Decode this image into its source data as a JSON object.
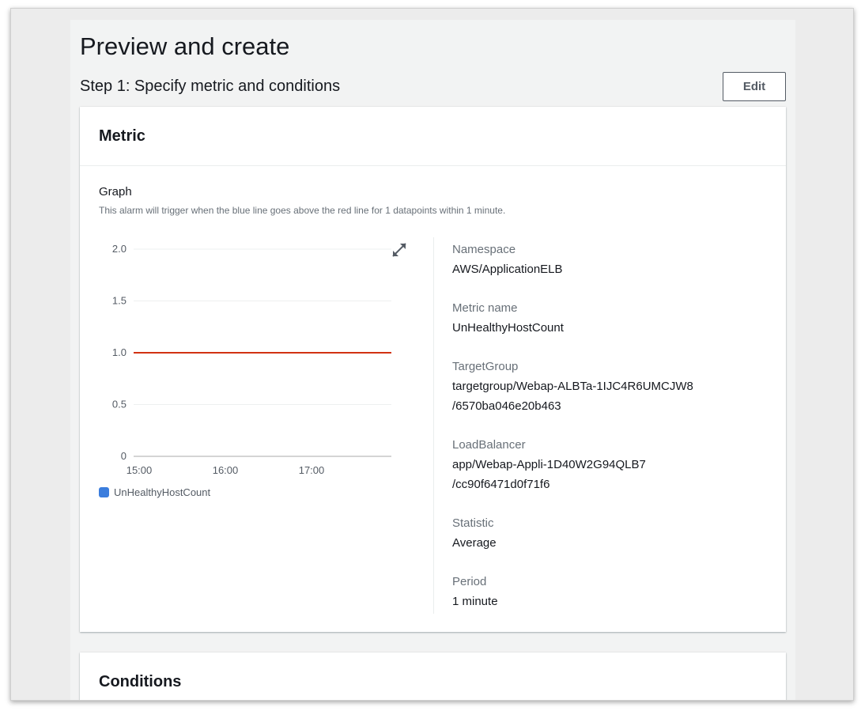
{
  "page": {
    "title": "Preview and create"
  },
  "step1": {
    "title": "Step 1: Specify metric and conditions",
    "edit_label": "Edit"
  },
  "metric_card": {
    "title": "Metric",
    "graph_label": "Graph",
    "graph_description": "This alarm will trigger when the blue line goes above the red line for 1 datapoints within 1 minute.",
    "details": [
      {
        "key": "Namespace",
        "value": "AWS/ApplicationELB"
      },
      {
        "key": "Metric name",
        "value": "UnHealthyHostCount"
      },
      {
        "key": "TargetGroup",
        "value": "targetgroup/Webap-ALBTa-1IJC4R6UMCJW8\n/6570ba046e20b463"
      },
      {
        "key": "LoadBalancer",
        "value": "app/Webap-Appli-1D40W2G94QLB7\n/cc90f6471d0f71f6"
      },
      {
        "key": "Statistic",
        "value": "Average"
      },
      {
        "key": "Period",
        "value": "1 minute"
      }
    ]
  },
  "chart_data": {
    "type": "line",
    "y_ticks": [
      "2.0",
      "1.5",
      "1.0",
      "0.5",
      "0"
    ],
    "ylim": [
      0,
      2.0
    ],
    "x_ticks": [
      "15:00",
      "16:00",
      "17:00"
    ],
    "series": [
      {
        "name": "UnHealthyHostCount",
        "color": "#3b7ddd",
        "values": []
      }
    ],
    "threshold": {
      "value": 1.0,
      "color": "#d13212"
    },
    "legend": "bottom-left",
    "grid": true
  },
  "conditions_card": {
    "title": "Conditions"
  },
  "icons": {
    "expand": "expand-icon"
  }
}
